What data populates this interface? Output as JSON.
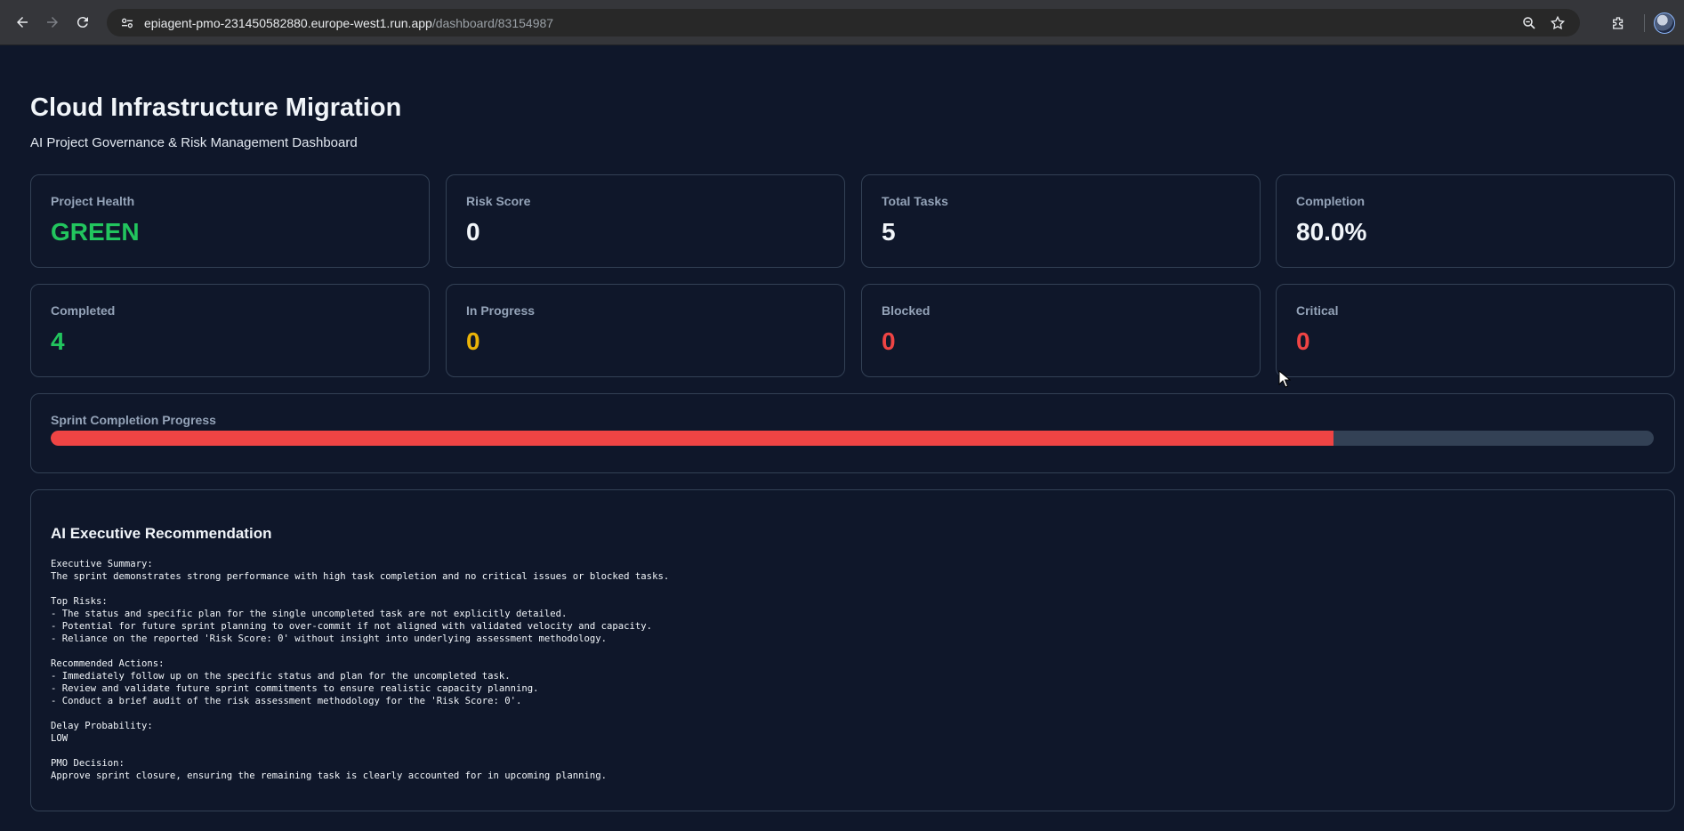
{
  "browser": {
    "url_host": "epiagent-pmo-231450582880.europe-west1.run.app",
    "url_path": "/dashboard/83154987"
  },
  "header": {
    "title": "Cloud Infrastructure Migration",
    "subtitle": "AI Project Governance & Risk Management Dashboard"
  },
  "metrics": [
    {
      "label": "Project Health",
      "value": "GREEN",
      "color": "#22c55e"
    },
    {
      "label": "Risk Score",
      "value": "0",
      "color": "#f1f5f9"
    },
    {
      "label": "Total Tasks",
      "value": "5",
      "color": "#f1f5f9"
    },
    {
      "label": "Completion",
      "value": "80.0%",
      "color": "#f1f5f9"
    }
  ],
  "status_counts": [
    {
      "label": "Completed",
      "value": "4",
      "color": "#22c55e"
    },
    {
      "label": "In Progress",
      "value": "0",
      "color": "#eab308"
    },
    {
      "label": "Blocked",
      "value": "0",
      "color": "#ef4444"
    },
    {
      "label": "Critical",
      "value": "0",
      "color": "#ef4444"
    }
  ],
  "progress": {
    "label": "Sprint Completion Progress",
    "percent": 80,
    "fill_color": "#ef4444"
  },
  "recommendation": {
    "title": "AI Executive Recommendation",
    "body": "Executive Summary:\nThe sprint demonstrates strong performance with high task completion and no critical issues or blocked tasks.\n\nTop Risks:\n- The status and specific plan for the single uncompleted task are not explicitly detailed.\n- Potential for future sprint planning to over-commit if not aligned with validated velocity and capacity.\n- Reliance on the reported 'Risk Score: 0' without insight into underlying assessment methodology.\n\nRecommended Actions:\n- Immediately follow up on the specific status and plan for the uncompleted task.\n- Review and validate future sprint commitments to ensure realistic capacity planning.\n- Conduct a brief audit of the risk assessment methodology for the 'Risk Score: 0'.\n\nDelay Probability:\nLOW\n\nPMO Decision:\nApprove sprint closure, ensuring the remaining task is clearly accounted for in upcoming planning."
  },
  "icons": [
    "back-icon",
    "forward-icon",
    "reload-icon",
    "site-info-icon",
    "zoom-icon",
    "bookmark-star-icon",
    "extensions-icon",
    "profile-avatar"
  ]
}
